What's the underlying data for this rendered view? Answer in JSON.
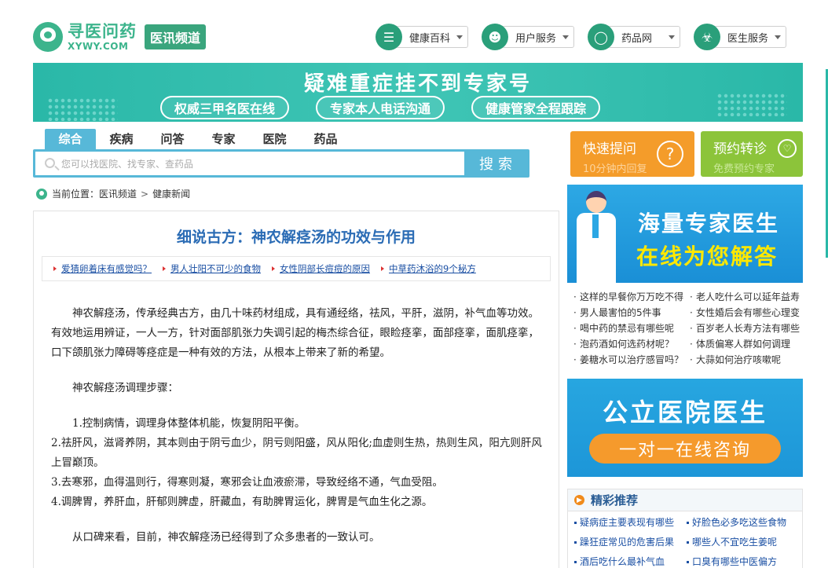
{
  "header": {
    "logo_cn": "寻医问药",
    "logo_en": "XYWY.COM",
    "channel": "医讯频道",
    "menus": [
      {
        "label": "健康百科",
        "icon": "list-icon"
      },
      {
        "label": "用户服务",
        "icon": "user-icon"
      },
      {
        "label": "药品网",
        "icon": "pill-icon"
      },
      {
        "label": "医生服务",
        "icon": "doctor-icon"
      }
    ]
  },
  "banner": {
    "title": "疑难重症挂不到专家号",
    "pills": [
      "权威三甲名医在线",
      "专家本人电话沟通",
      "健康管家全程跟踪"
    ]
  },
  "search": {
    "tabs": [
      "综合",
      "疾病",
      "问答",
      "专家",
      "医院",
      "药品"
    ],
    "active_tab": "综合",
    "placeholder": "您可以找医院、找专家、查药品",
    "button": "搜索"
  },
  "breadcrumb": {
    "prefix": "当前位置：",
    "items": [
      "医讯频道",
      "健康新闻"
    ]
  },
  "article": {
    "title": "细说古方：神农解痉汤的功效与作用",
    "related": [
      "爱猜卵着床有感觉吗？",
      "男人壮阳不可少的食物",
      "女性阴部长痘痘的原因",
      "中草药沐浴的9个秘方"
    ],
    "para1": "神农解痉汤，传承经典古方，由几十味药材组成，具有通经络，祛风，平肝，滋阴，补气血等功效。 有效地运用辨证，一人一方，针对面部肌张力失调引起的梅杰综合征，眼睑痉挛，面部痉挛，面肌痉挛，口下颌肌张力障碍等痉症是一种有效的方法，从根本上带来了新的希望。",
    "para2": "神农解痉汤调理步骤：",
    "steps": [
      "1.控制病情，调理身体整体机能，恢复阴阳平衡。",
      "2.祛肝风，滋肾养阴，其本则由于阴亏血少，阴亏则阳盛，风从阳化;血虚则生热，热则生风，阳亢则肝风上冒巅顶。",
      "3.去寒邪，血得温则行，得寒则凝，寒邪会让血液瘀滞，导致经络不通，气血受阻。",
      "4.调脾胃，养肝血，肝郁则脾虚，肝藏血，有助脾胃运化，脾胃是气血生化之源。"
    ],
    "para3": "从口碑来看，目前，神农解痉汤已经得到了众多患者的一致认可。"
  },
  "sidebar": {
    "quick": [
      {
        "title": "快速提问",
        "sub": "10分钟内回复",
        "icon": "question-icon"
      },
      {
        "title": "预约转诊",
        "sub": "免费预约专家",
        "icon": "stethoscope-icon"
      }
    ],
    "promo1": {
      "line1": "海量专家医生",
      "line2": "在线为您解答"
    },
    "links": [
      "这样的早餐你万万吃不得",
      "老人吃什么可以延年益寿",
      "男人最害怕的5件事",
      "女性婚后会有哪些心理变",
      "喝中药的禁忌有哪些呢",
      "百岁老人长寿方法有哪些",
      "泡药酒如何选药材呢？",
      "体质偏寒人群如何调理",
      "姜糖水可以治疗感冒吗？",
      "大蒜如何治疗咳嗽呢"
    ],
    "promo2": {
      "title": "公立医院医生",
      "button": "一对一在线咨询"
    },
    "recommend": {
      "title": "精彩推荐",
      "items": [
        "疑病症主要表现有哪些",
        "好脸色必多吃这些食物",
        "躁狂症常见的危害后果",
        "哪些人不宜吃生姜呢",
        "酒后吃什么最补气血",
        "口臭有哪些中医偏方"
      ]
    }
  }
}
